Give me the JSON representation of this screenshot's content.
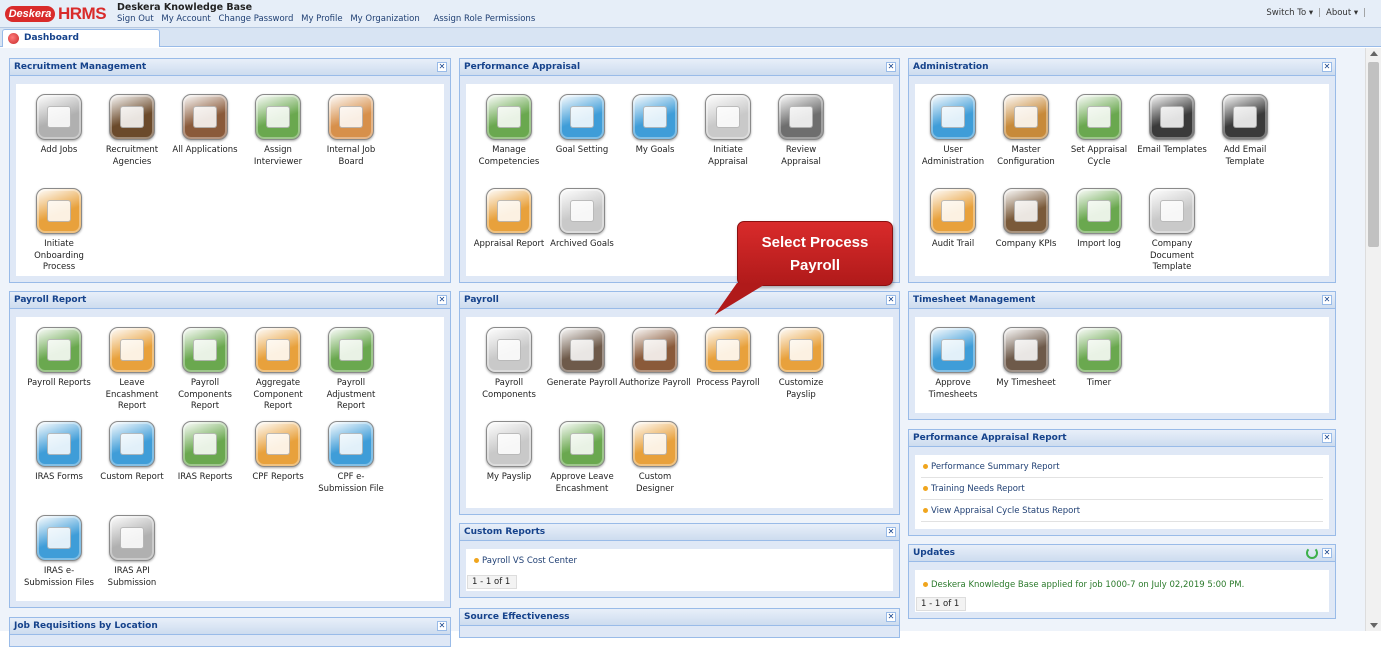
{
  "app": {
    "brand_desk": "Deskera",
    "brand_hrms": "HRMS",
    "title": "Deskera Knowledge Base"
  },
  "toplinks": [
    "Sign Out",
    "My Account",
    "Change Password",
    "My Profile",
    "My Organization",
    "Assign Role Permissions"
  ],
  "topright": {
    "switch": "Switch To ▾",
    "about": "About ▾"
  },
  "tab": {
    "label": "Dashboard"
  },
  "callout": {
    "line1": "Select Process",
    "line2": "Payroll",
    "color": "#c62020"
  },
  "panels": {
    "recruitment": {
      "title": "Recruitment Management",
      "items": [
        {
          "label": "Add Jobs",
          "icon": "briefcase-add-icon",
          "color": "#b0b0b0"
        },
        {
          "label": "Recruitment Agencies",
          "icon": "person-icon",
          "color": "#6b4a2b"
        },
        {
          "label": "All Applications",
          "icon": "grid-icon",
          "color": "#8a5a3a"
        },
        {
          "label": "Assign Interviewer",
          "icon": "clipboard-icon",
          "color": "#6aa84f"
        },
        {
          "label": "Internal Job Board",
          "icon": "board-icon",
          "color": "#d7904b"
        },
        {
          "label": "Initiate Onboarding Process",
          "icon": "people-gear-icon",
          "color": "#e8a13c"
        }
      ]
    },
    "appraisal": {
      "title": "Performance Appraisal",
      "items": [
        {
          "label": "Manage Competencies",
          "icon": "people-icon",
          "color": "#6aa84f"
        },
        {
          "label": "Goal Setting",
          "icon": "target-icon",
          "color": "#3f9dd8"
        },
        {
          "label": "My Goals",
          "icon": "target-icon",
          "color": "#3f9dd8"
        },
        {
          "label": "Initiate Appraisal",
          "icon": "person-card-icon",
          "color": "#c9c9c9"
        },
        {
          "label": "Review Appraisal",
          "icon": "notebook-icon",
          "color": "#6e6e6e"
        },
        {
          "label": "Appraisal Report",
          "icon": "document-icon",
          "color": "#e8a13c"
        },
        {
          "label": "Archived Goals",
          "icon": "archive-icon",
          "color": "#c9c9c9"
        }
      ]
    },
    "administration": {
      "title": "Administration",
      "items": [
        {
          "label": "User Administration",
          "icon": "user-icon",
          "color": "#3f9dd8"
        },
        {
          "label": "Master Configuration",
          "icon": "gear-icon",
          "color": "#c78a3a"
        },
        {
          "label": "Set Appraisal Cycle",
          "icon": "cycle-icon",
          "color": "#6aa84f"
        },
        {
          "label": "Email Templates",
          "icon": "template-icon",
          "color": "#3a3a3a"
        },
        {
          "label": "Add Email Template",
          "icon": "template-add-icon",
          "color": "#3a3a3a"
        },
        {
          "label": "Audit Trail",
          "icon": "folder-icon",
          "color": "#e8a13c"
        },
        {
          "label": "Company KPIs",
          "icon": "gauge-icon",
          "color": "#7a5a3a"
        },
        {
          "label": "Import log",
          "icon": "import-icon",
          "color": "#6aa84f"
        },
        {
          "label": "Company Document Template",
          "icon": "documents-icon",
          "color": "#c9c9c9"
        }
      ]
    },
    "payroll_report": {
      "title": "Payroll Report",
      "items": [
        {
          "label": "Payroll Reports",
          "icon": "bar-chart-icon",
          "color": "#6aa84f"
        },
        {
          "label": "Leave Encashment Report",
          "icon": "report-icon",
          "color": "#e8a13c"
        },
        {
          "label": "Payroll Components Report",
          "icon": "report-tools-icon",
          "color": "#6aa84f"
        },
        {
          "label": "Aggregate Component Report",
          "icon": "report-stack-icon",
          "color": "#e8a13c"
        },
        {
          "label": "Payroll Adjustment Report",
          "icon": "report-gear-icon",
          "color": "#6aa84f"
        },
        {
          "label": "IRAS Forms",
          "icon": "percent-dollar-icon",
          "color": "#3f9dd8"
        },
        {
          "label": "Custom Report",
          "icon": "pie-chart-icon",
          "color": "#3f9dd8"
        },
        {
          "label": "IRAS Reports",
          "icon": "report-list-icon",
          "color": "#6aa84f"
        },
        {
          "label": "CPF Reports",
          "icon": "report-bars-icon",
          "color": "#e8a13c"
        },
        {
          "label": "CPF e-Submission File",
          "icon": "report-globe-icon",
          "color": "#3f9dd8"
        },
        {
          "label": "IRAS e-Submission Files",
          "icon": "percent-dollar-icon",
          "color": "#3f9dd8"
        },
        {
          "label": "IRAS API Submission",
          "icon": "api-gear-icon",
          "color": "#b0b0b0"
        }
      ]
    },
    "payroll": {
      "title": "Payroll",
      "items": [
        {
          "label": "Payroll Components",
          "icon": "tools-icon",
          "color": "#c9c9c9"
        },
        {
          "label": "Generate Payroll",
          "icon": "checklist-icon",
          "color": "#6e5a4a"
        },
        {
          "label": "Authorize Payroll",
          "icon": "clipboard-coins-icon",
          "color": "#8a5a3a"
        },
        {
          "label": "Process Payroll",
          "icon": "person-coins-icon",
          "color": "#e8a13c"
        },
        {
          "label": "Customize Payslip",
          "icon": "payslip-edit-icon",
          "color": "#e8a13c"
        },
        {
          "label": "My Payslip",
          "icon": "payslip-icon",
          "color": "#c9c9c9"
        },
        {
          "label": "Approve Leave Encashment",
          "icon": "approve-icon",
          "color": "#6aa84f"
        },
        {
          "label": "Custom Designer",
          "icon": "designer-icon",
          "color": "#e8a13c"
        }
      ]
    },
    "timesheet": {
      "title": "Timesheet Management",
      "items": [
        {
          "label": "Approve Timesheets",
          "icon": "clock-check-icon",
          "color": "#3f9dd8"
        },
        {
          "label": "My Timesheet",
          "icon": "clock-person-icon",
          "color": "#6e5a4a"
        },
        {
          "label": "Timer",
          "icon": "stopwatch-icon",
          "color": "#6aa84f"
        }
      ]
    },
    "perf_report": {
      "title": "Performance Appraisal Report",
      "links": [
        "Performance Summary Report",
        "Training Needs Report",
        "View Appraisal Cycle Status Report"
      ]
    },
    "custom_reports": {
      "title": "Custom Reports",
      "links": [
        "Payroll VS Cost Center"
      ],
      "pager": "1 - 1 of 1"
    },
    "updates": {
      "title": "Updates",
      "entry_link": "Deskera Knowledge Base",
      "entry_text": "applied for job 1000-7 on July 02,2019 5:00 PM.",
      "pager": "1 - 1 of 1"
    },
    "source": {
      "title": "Source Effectiveness"
    },
    "job_req": {
      "title": "Job Requisitions by Location"
    }
  }
}
